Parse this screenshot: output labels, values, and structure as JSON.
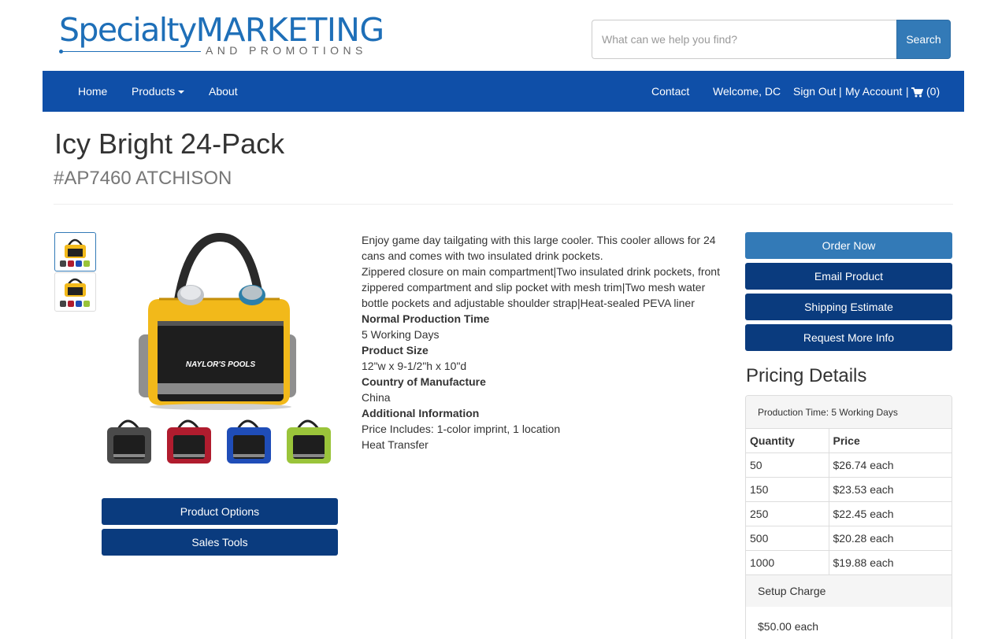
{
  "header": {
    "logo_main_1": "Specialty",
    "logo_main_2": "MARKETING",
    "logo_sub": "AND PROMOTIONS",
    "search_placeholder": "What can we help you find?",
    "search_button": "Search"
  },
  "nav": {
    "home": "Home",
    "products": "Products",
    "about": "About",
    "contact": "Contact",
    "welcome": "Welcome, DC",
    "signout": "Sign Out",
    "separator1": "|",
    "account": "My Account",
    "separator2": "|",
    "cart": "(0)"
  },
  "product": {
    "title": "Icy Bright 24-Pack",
    "sku": "#AP7460 ATCHISON",
    "bag_text": "NAYLOR'S POOLS",
    "description_1": "Enjoy game day tailgating with this large cooler. This cooler allows for 24 cans and comes with two insulated drink pockets.",
    "description_2": "Zippered closure on main compartment|Two insulated drink pockets, front zippered compartment and slip pocket with mesh trim|Two mesh water bottle pockets and adjustable shoulder strap|Heat-sealed PEVA liner",
    "specs": [
      {
        "label": "Normal Production Time",
        "value": "5 Working Days"
      },
      {
        "label": "Product Size",
        "value": "12\"w x 9-1/2\"h x 10\"d"
      },
      {
        "label": "Country of Manufacture",
        "value": "China"
      },
      {
        "label": "Additional Information",
        "value": "Price Includes: 1-color imprint, 1 location",
        "value2": "Heat Transfer"
      }
    ],
    "left_buttons": {
      "options": "Product Options",
      "sales": "Sales Tools"
    }
  },
  "actions": {
    "order": "Order Now",
    "email": "Email Product",
    "shipping": "Shipping Estimate",
    "request": "Request More Info"
  },
  "pricing": {
    "title": "Pricing Details",
    "production_time": "Production Time: 5 Working Days",
    "col_qty": "Quantity",
    "col_price": "Price",
    "rows": [
      {
        "qty": "50",
        "price": "$26.74 each"
      },
      {
        "qty": "150",
        "price": "$23.53 each"
      },
      {
        "qty": "250",
        "price": "$22.45 each"
      },
      {
        "qty": "500",
        "price": "$20.28 each"
      },
      {
        "qty": "1000",
        "price": "$19.88 each"
      }
    ],
    "setup_label": "Setup Charge",
    "setup_value": "$50.00 each"
  },
  "colors": {
    "nav_bg": "#0f4fa8",
    "btn_primary": "#337ab7",
    "btn_dark": "#0a3b7e",
    "bag_yellow": "#f2b91a"
  }
}
